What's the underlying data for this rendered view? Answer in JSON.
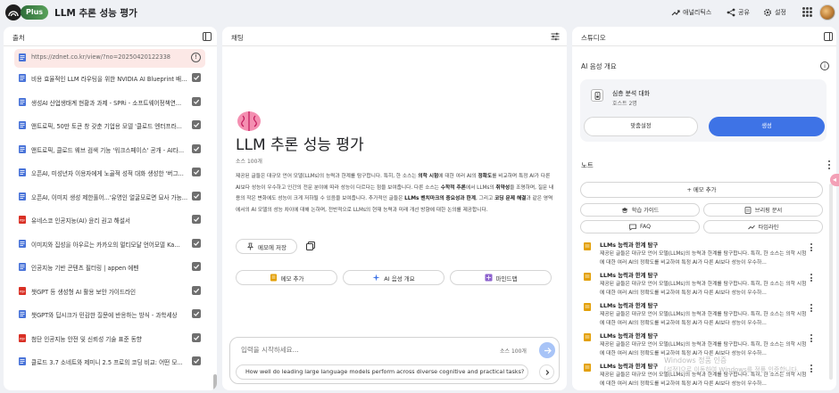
{
  "app": {
    "plan_badge": "Plus",
    "notebook_title": "LLM 추론 성능 평가",
    "analytics_label": "애널리틱스",
    "share_label": "공유",
    "settings_label": "설정"
  },
  "sources": {
    "title": "출처",
    "highlighted_url": "https://zdnet.co.kr/view/?no=20250420122338",
    "items": [
      "비용 효율적인 LLM 라우팅을 위한 NVIDIA AI Blueprint 배...",
      "생성AI 산업생태계 현황과 과제 - SPRi - 소프트웨어정책연...",
      "앤트로픽, 50만 토큰 창 갖춘 기업용 모델 '클로드 엔터프라...",
      "앤트로픽, 클로드 웨브 검색 기능 '워크스페이스' 공개 - AI타...",
      "오픈AI, 미성년자 이용자에게 노골적 성적 대화 생성한 '버그...",
      "오픈AI, 이미지 생성 제한풀어...'유명인 얼굴모로면 묘사 가능...",
      "유네스코 인공지능(AI) 윤리 권고 해설서",
      "이미지와 집성을 아우르는 카카오의 멀티모달 언어모델 Ka...",
      "인공지능 기반 콘텐츠 필터링 | appen 에펜",
      "챗GPT 등 생성형 AI 활용 보안 가이드라인",
      "챗GPT와 딥시크가 민감한 질문에 반응하는 방식 - 과학세상",
      "첨단 인공지능 안전 및 신뢰성 기술 표준 동향",
      "클로드 3.7 소네트와 제미니 2.5 프로의 코딩 비교: 어떤 모..."
    ],
    "item_types": [
      "doc",
      "doc",
      "doc",
      "doc",
      "doc",
      "doc",
      "pdf",
      "doc",
      "doc",
      "pdf",
      "doc",
      "pdf",
      "doc"
    ]
  },
  "chat": {
    "title": "채팅",
    "source_count": "소스 100개",
    "summary_parts": [
      {
        "t": "제공된 글들은 대규모 언어 모델(LLMs)의 능력과 한계를 탐구합니다. 특히, 한 소스는 ",
        "b": false
      },
      {
        "t": "의학 시험",
        "b": true
      },
      {
        "t": "에 대한 여러 AI의 ",
        "b": false
      },
      {
        "t": "정확도",
        "b": true
      },
      {
        "t": "를 비교하며 특정 AI가 다른 AI보다 성능이 우수하고 인간의 전문 분야에 따라 성능이 다르다는 점을 보여줍니다. 다른 소스는 ",
        "b": false
      },
      {
        "t": "수학적 추론",
        "b": true
      },
      {
        "t": "에서 LLMs의 ",
        "b": false
      },
      {
        "t": "취약성",
        "b": true
      },
      {
        "t": "을 조명하며, 질문 내용의 작은 변화에도 성능이 크게 저하될 수 있음을 보여줍니다. 추가적인 글들은 ",
        "b": false
      },
      {
        "t": "LLMs 벤치마크의 중요성과 한계",
        "b": true
      },
      {
        "t": ", 그리고 ",
        "b": false
      },
      {
        "t": "코딩 문제 해결",
        "b": true
      },
      {
        "t": "과 같은 영역에서의 AI 모델의 성능 차이에 대해 논하며, 전반적으로 LLMs의 현재 능력과 미래 개선 방향에 대한 논의를 제공합니다.",
        "b": false
      }
    ],
    "save_note": "메모에 저장",
    "pill_add_memo": "메모 추가",
    "pill_audio": "AI 음성 개요",
    "pill_mindmap": "마인드맵",
    "input_placeholder": "입력을 시작하세요...",
    "input_count": "소스 100개",
    "suggestion": "How well do leading large language models perform across diverse cognitive and practical tasks?"
  },
  "studio": {
    "title": "스튜디오",
    "audio_overview": "AI 음성 개요",
    "card_title": "심층 분석 대화",
    "card_sub": "호스트 2명",
    "btn_customize": "맞춤설정",
    "btn_generate": "생성",
    "notes_label": "노트",
    "add_memo": "+ 메모 추가",
    "chips": [
      "학습 가이드",
      "브리핑 문서",
      "FAQ",
      "타임라인"
    ],
    "notes": [
      {
        "title": "LLMs 능력과 한계 탐구",
        "body": "제공된 글들은 대규모 언어 모델(LLMs)의 능력과 한계를 탐구합니다. 특히, 한 소스는 의학 시험에 대한 여러 AI의 정확도를 비교하여 특정 AI가 다른 AI보다 성능이 우수하..."
      },
      {
        "title": "LLMs 능력과 한계 탐구",
        "body": "제공된 글들은 대규모 언어 모델(LLMs)의 능력과 한계를 탐구합니다. 특히, 한 소스는 의학 시험에 대한 여러 AI의 정확도를 비교하여 특정 AI가 다른 AI보다 성능이 우수하..."
      },
      {
        "title": "LLMs 능력과 한계 탐구",
        "body": "제공된 글들은 대규모 언어 모델(LLMs)의 능력과 한계를 탐구합니다. 특히, 한 소스는 의학 시험에 대한 여러 AI의 정확도를 비교하여 특정 AI가 다른 AI보다 성능이 우수하..."
      },
      {
        "title": "LLMs 능력과 한계 탐구",
        "body": "제공된 글들은 대규모 언어 모델(LLMs)의 능력과 한계를 탐구합니다. 특히, 한 소스는 의학 시험에 대한 여러 AI의 정확도를 비교하여 특정 AI가 다른 AI보다 성능이 우수하..."
      },
      {
        "title": "LLMs 능력과 한계 탐구",
        "body": "제공된 글들은 대규모 언어 모델(LLMs)의 능력과 한계를 탐구합니다. 특히, 한 소스는 의학 시험에 대한 여러 AI의 정확도를 비교하여 특정 AI가 다른 AI보다 성능이 우수하..."
      }
    ],
    "watermark_1": "Windows 정품 인증",
    "watermark_2": "[설정]으로 이동하여 Windows를 정품 인증합니다."
  },
  "colors": {
    "accent_blue": "#3e73e6",
    "highlight_bg": "#fce8e6",
    "pdf_red": "#d93025",
    "doc_blue": "#4a74d9",
    "note_yellow": "#e3a008"
  }
}
